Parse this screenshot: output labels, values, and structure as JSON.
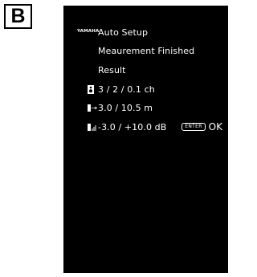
{
  "figure_label": "B",
  "screen": {
    "brand_icon_text": "YAMAHA",
    "title": "Auto Setup",
    "status": "Meaurement Finished",
    "section": "Result",
    "results": {
      "channels": "3 / 2 / 0.1 ch",
      "distance": "3.0 / 10.5 m",
      "level": "-3.0 / +10.0 dB"
    },
    "enter_key_label": "ENTER",
    "confirm_label": "OK"
  }
}
